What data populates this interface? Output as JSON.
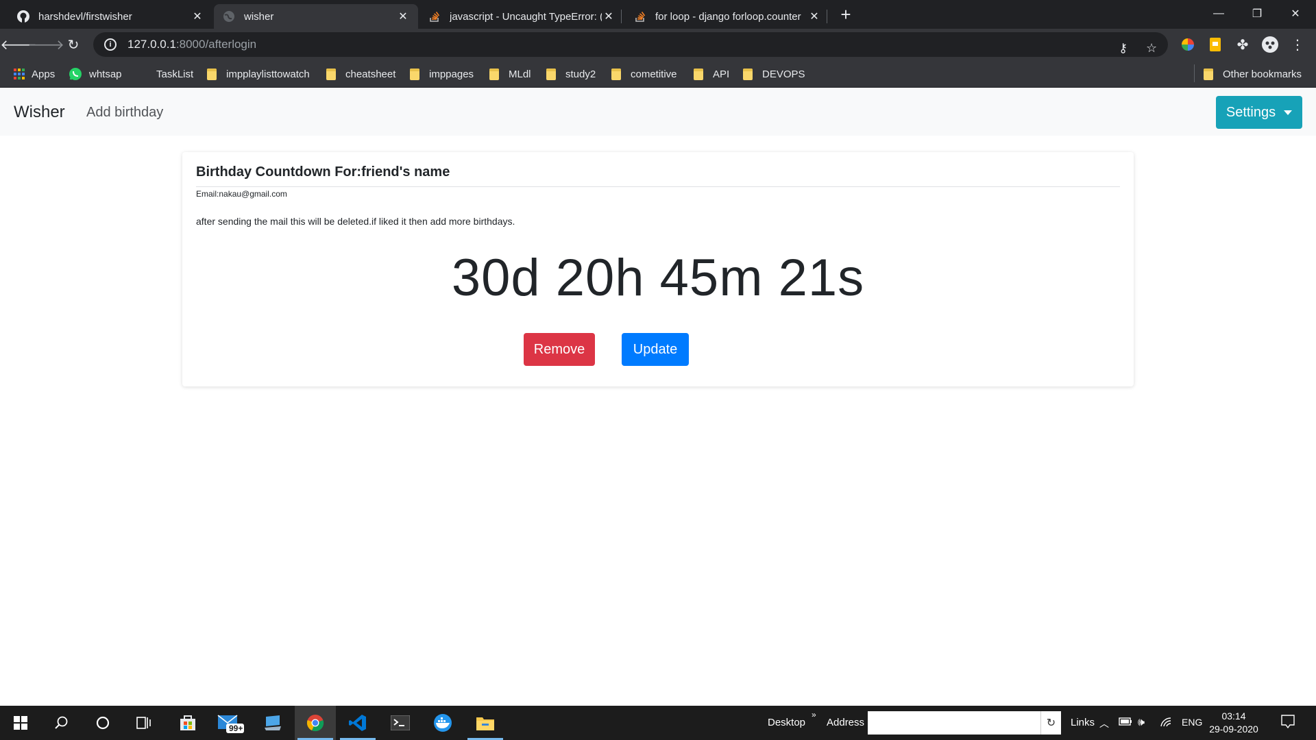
{
  "browser": {
    "tabs": [
      {
        "title": "harshdevl/firstwisher",
        "icon": "github-icon"
      },
      {
        "title": "wisher",
        "icon": "globe-icon",
        "active": true
      },
      {
        "title": "javascript - Uncaught TypeError: (",
        "icon": "stackoverflow-icon"
      },
      {
        "title": "for loop - django forloop.counter",
        "icon": "stackoverflow-icon"
      }
    ],
    "url_host": "127.0.0.1",
    "url_path": ":8000/afterlogin",
    "bookmarks": [
      "Apps",
      "whtsap",
      "TaskList",
      "impplaylisttowatch",
      "cheatsheet",
      "imppages",
      "MLdl",
      "study2",
      "cometitive",
      "API",
      "DEVOPS"
    ],
    "other_bookmarks": "Other bookmarks"
  },
  "navbar": {
    "brand": "Wisher",
    "add_birthday": "Add birthday",
    "settings": "Settings"
  },
  "card": {
    "title": "Birthday Countdown For:friend's name",
    "email": "Email:nakau@gmail.com",
    "note": "after sending the mail this will be deleted.if liked it then add more birthdays.",
    "countdown": "30d 20h 45m 21s",
    "remove_label": "Remove",
    "update_label": "Update"
  },
  "taskbar": {
    "mail_badge": "99+",
    "desktop": "Desktop",
    "address": "Address",
    "links": "Links",
    "lang": "ENG",
    "time": "03:14",
    "date": "29-09-2020"
  },
  "colors": {
    "danger": "#dc3545",
    "primary": "#007bff",
    "info": "#17a2b8"
  }
}
